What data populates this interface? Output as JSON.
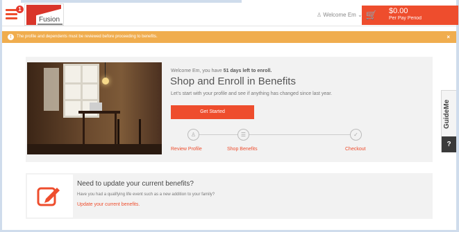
{
  "header": {
    "menu_badge": "1",
    "logo_text": "Fusion",
    "welcome_text": "Welcome Em",
    "cart_amount": "$0.00",
    "cart_period": "Per Pay Period"
  },
  "alert": {
    "message": "The profile and dependents must be reviewed before proceeding to benefits.",
    "close": "×"
  },
  "enroll": {
    "welcome_prefix": "Welcome Em, you have ",
    "days_left": "51 days left to enroll.",
    "title": "Shop and Enroll in Benefits",
    "subtitle": "Let's start with your profile and see if anything has changed since last year.",
    "button": "Get Started",
    "steps": [
      {
        "label": "Review Profile",
        "icon": "user-icon"
      },
      {
        "label": "Shop Benefits",
        "icon": "cart-icon"
      },
      {
        "label": "Checkout",
        "icon": "check-icon"
      }
    ]
  },
  "update": {
    "title": "Need to update your current benefits?",
    "subtitle": "Have you had a qualifying life event such as a new addition to your family?",
    "link": "Update your current benefits."
  },
  "guideme": {
    "label": "GuideMe",
    "q": "?"
  },
  "colors": {
    "accent": "#ee4d2d",
    "alert": "#f0ad4e"
  }
}
